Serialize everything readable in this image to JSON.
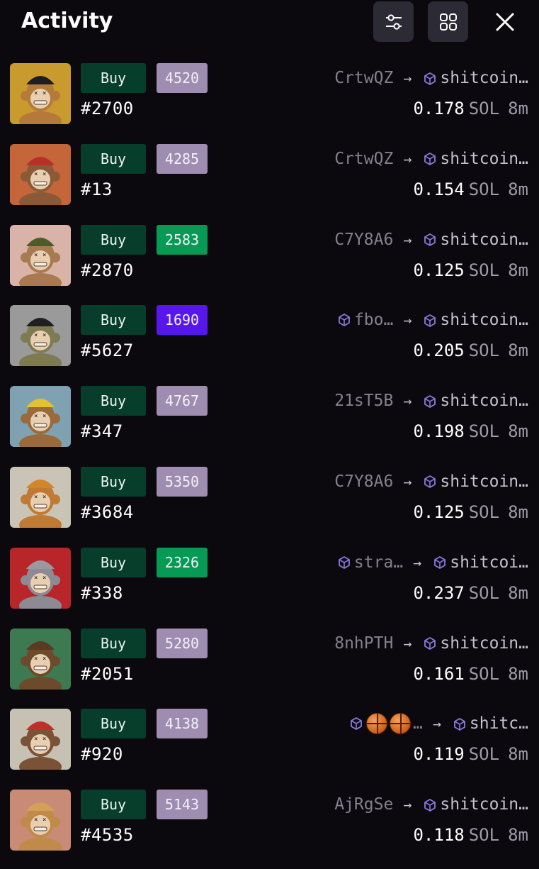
{
  "header": {
    "title": "Activity",
    "filter_icon": "filter-sliders-icon",
    "grid_icon": "grid-view-icon",
    "close_icon": "close-icon"
  },
  "colors": {
    "background": "#0b090e",
    "buy_bg": "#063d2b",
    "rank_gray": "#9e8db0",
    "rank_green": "#069a55",
    "rank_purple": "#5716eb",
    "icon_button_bg": "#2c2a35"
  },
  "activity": [
    {
      "action": "Buy",
      "rank": "4520",
      "rank_color": "#9e8db0",
      "token": "#2700",
      "from": "CrtwQZ",
      "from_icon": false,
      "to": "shitcoin…",
      "price": "0.178",
      "unit": "SOL",
      "time": "8m",
      "bg": "#c99a2e",
      "hat": "#1e1e1e",
      "fur": "#b57a3a"
    },
    {
      "action": "Buy",
      "rank": "4285",
      "rank_color": "#9e8db0",
      "token": "#13",
      "from": "CrtwQZ",
      "from_icon": false,
      "to": "shitcoin…",
      "price": "0.154",
      "unit": "SOL",
      "time": "8m",
      "bg": "#c5663a",
      "hat": "#b8302a",
      "fur": "#8a5a36"
    },
    {
      "action": "Buy",
      "rank": "2583",
      "rank_color": "#069a55",
      "token": "#2870",
      "from": "C7Y8A6",
      "from_icon": false,
      "to": "shitcoin…",
      "price": "0.125",
      "unit": "SOL",
      "time": "8m",
      "bg": "#d9b3a8",
      "hat": "#4f5a2a",
      "fur": "#a87a52"
    },
    {
      "action": "Buy",
      "rank": "1690",
      "rank_color": "#5716eb",
      "token": "#5627",
      "from": "fbo…",
      "from_icon": true,
      "to": "shitcoin…",
      "price": "0.205",
      "unit": "SOL",
      "time": "8m",
      "bg": "#9a9a9a",
      "hat": "#202020",
      "fur": "#7e7a52"
    },
    {
      "action": "Buy",
      "rank": "4767",
      "rank_color": "#9e8db0",
      "token": "#347",
      "from": "21sT5B",
      "from_icon": false,
      "to": "shitcoin…",
      "price": "0.198",
      "unit": "SOL",
      "time": "8m",
      "bg": "#7fa2b2",
      "hat": "#e2c22e",
      "fur": "#9a6a3c"
    },
    {
      "action": "Buy",
      "rank": "5350",
      "rank_color": "#9e8db0",
      "token": "#3684",
      "from": "C7Y8A6",
      "from_icon": false,
      "to": "shitcoin…",
      "price": "0.125",
      "unit": "SOL",
      "time": "8m",
      "bg": "#c9c4b6",
      "hat": "#d2862a",
      "fur": "#c07a34"
    },
    {
      "action": "Buy",
      "rank": "2326",
      "rank_color": "#069a55",
      "token": "#338",
      "from": "stra…",
      "from_icon": true,
      "to": "shitcoi…",
      "price": "0.237",
      "unit": "SOL",
      "time": "8m",
      "bg": "#b8262a",
      "hat": "#9a98a0",
      "fur": "#8d8a94"
    },
    {
      "action": "Buy",
      "rank": "5280",
      "rank_color": "#9e8db0",
      "token": "#2051",
      "from": "8nhPTH",
      "from_icon": false,
      "to": "shitcoin…",
      "price": "0.161",
      "unit": "SOL",
      "time": "8m",
      "bg": "#3d7a52",
      "hat": "#5a3a22",
      "fur": "#6e4a2c"
    },
    {
      "action": "Buy",
      "rank": "4138",
      "rank_color": "#9e8db0",
      "token": "#920",
      "from": "…",
      "from_icon": true,
      "from_emoji": [
        "basketball-emoji",
        "basketball-emoji"
      ],
      "to": "shitc…",
      "price": "0.119",
      "unit": "SOL",
      "time": "8m",
      "bg": "#c7c1b4",
      "hat": "#c0302a",
      "fur": "#7a5236"
    },
    {
      "action": "Buy",
      "rank": "5143",
      "rank_color": "#9e8db0",
      "token": "#4535",
      "from": "AjRgSe",
      "from_icon": false,
      "to": "shitcoin…",
      "price": "0.118",
      "unit": "SOL",
      "time": "8m",
      "bg": "#c98a76",
      "hat": "#d3a05a",
      "fur": "#c08a48"
    }
  ]
}
